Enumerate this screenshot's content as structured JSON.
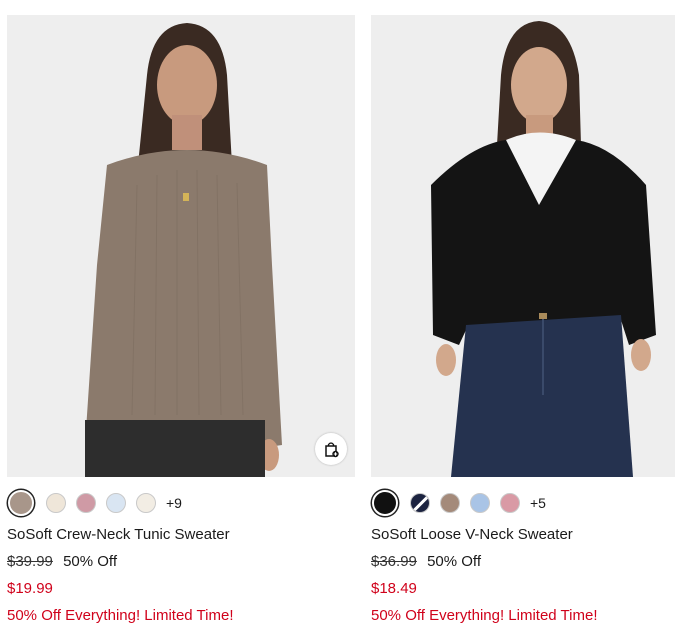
{
  "products": [
    {
      "name": "SoSoft Crew-Neck Tunic Sweater",
      "original_price": "$39.99",
      "discount": "50% Off",
      "sale_price": "$19.99",
      "promo": "50% Off Everything! Limited Time!",
      "more_colors": "+9",
      "swatches": [
        "#a8968a",
        "#efe6d9",
        "#cf9aa5",
        "#d9e5f2",
        "#f2ede4"
      ],
      "selected_swatch": 0,
      "quick_add_icon": "shopping-bag-plus-icon"
    },
    {
      "name": "SoSoft Loose V-Neck Sweater",
      "original_price": "$36.99",
      "discount": "50% Off",
      "sale_price": "$18.49",
      "promo": "50% Off Everything! Limited Time!",
      "more_colors": "+5",
      "swatches": [
        "#111111",
        "navy-white-split",
        "#a48a7a",
        "#a9c4e6",
        "#d99aa5"
      ],
      "selected_swatch": 0
    }
  ],
  "colors": {
    "sale_red": "#d0021b",
    "photo_bg": "#eeeeee"
  }
}
